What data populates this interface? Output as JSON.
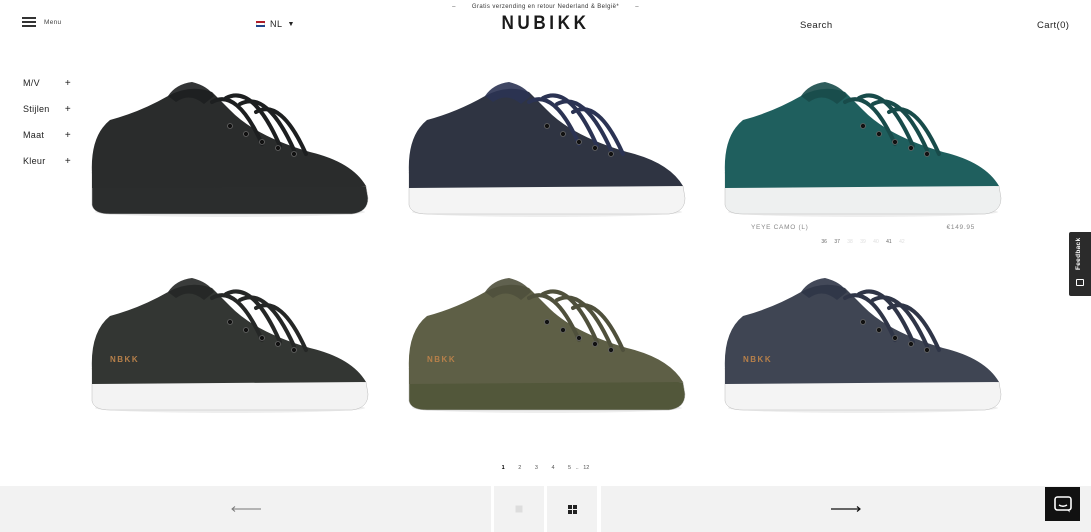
{
  "header": {
    "menu_label": "Menu",
    "language": "NL",
    "shipping_text": "Gratis verzending en retour Nederland & België*",
    "shipping_dash": "–",
    "logo": "NUBIKK",
    "search_label": "Search",
    "cart_label": "Cart(0)"
  },
  "filters": [
    {
      "label": "M/V",
      "toggle": "+"
    },
    {
      "label": "Stijlen",
      "toggle": "+"
    },
    {
      "label": "Maat",
      "toggle": "+"
    },
    {
      "label": "Kleur",
      "toggle": "+"
    }
  ],
  "products": [
    {
      "upper": "#2a2c2c",
      "sole": "#2b2d2d",
      "lace": "#1d1f20",
      "brand": ""
    },
    {
      "upper": "#2f3442",
      "sole": "#f4f4f4",
      "lace": "#2b3353",
      "brand": ""
    },
    {
      "upper": "#1f5f5e",
      "sole": "#eef0f0",
      "lace": "#184b4a",
      "brand": "",
      "name": "YEYE CAMO (L)",
      "price": "€149.95",
      "sizes": [
        {
          "s": "36",
          "a": true
        },
        {
          "s": "37",
          "a": true
        },
        {
          "s": "38",
          "a": false
        },
        {
          "s": "39",
          "a": false
        },
        {
          "s": "40",
          "a": false
        },
        {
          "s": "41",
          "a": true
        },
        {
          "s": "42",
          "a": false
        }
      ]
    },
    {
      "upper": "#333633",
      "sole": "#f3f3f3",
      "lace": "#252726",
      "brand": "NBKK"
    },
    {
      "upper": "#5e5f46",
      "sole": "#52573a",
      "lace": "#4f503c",
      "brand": "NBKK"
    },
    {
      "upper": "#3f4553",
      "sole": "#f4f4f4",
      "lace": "#2f3547",
      "brand": "NBKK"
    }
  ],
  "pagination": {
    "pages": [
      "1",
      "2",
      "3",
      "4",
      "5"
    ],
    "ellipsis": "..",
    "last": "12",
    "current": "1"
  },
  "bottom_bar": {
    "prev_icon": "arrow-left-icon",
    "single_view_icon": "single-square-icon",
    "grid_view_icon": "grid-icon",
    "next_icon": "arrow-right-icon"
  },
  "widgets": {
    "feedback_label": "Feedback",
    "chat_icon": "chat-icon"
  }
}
